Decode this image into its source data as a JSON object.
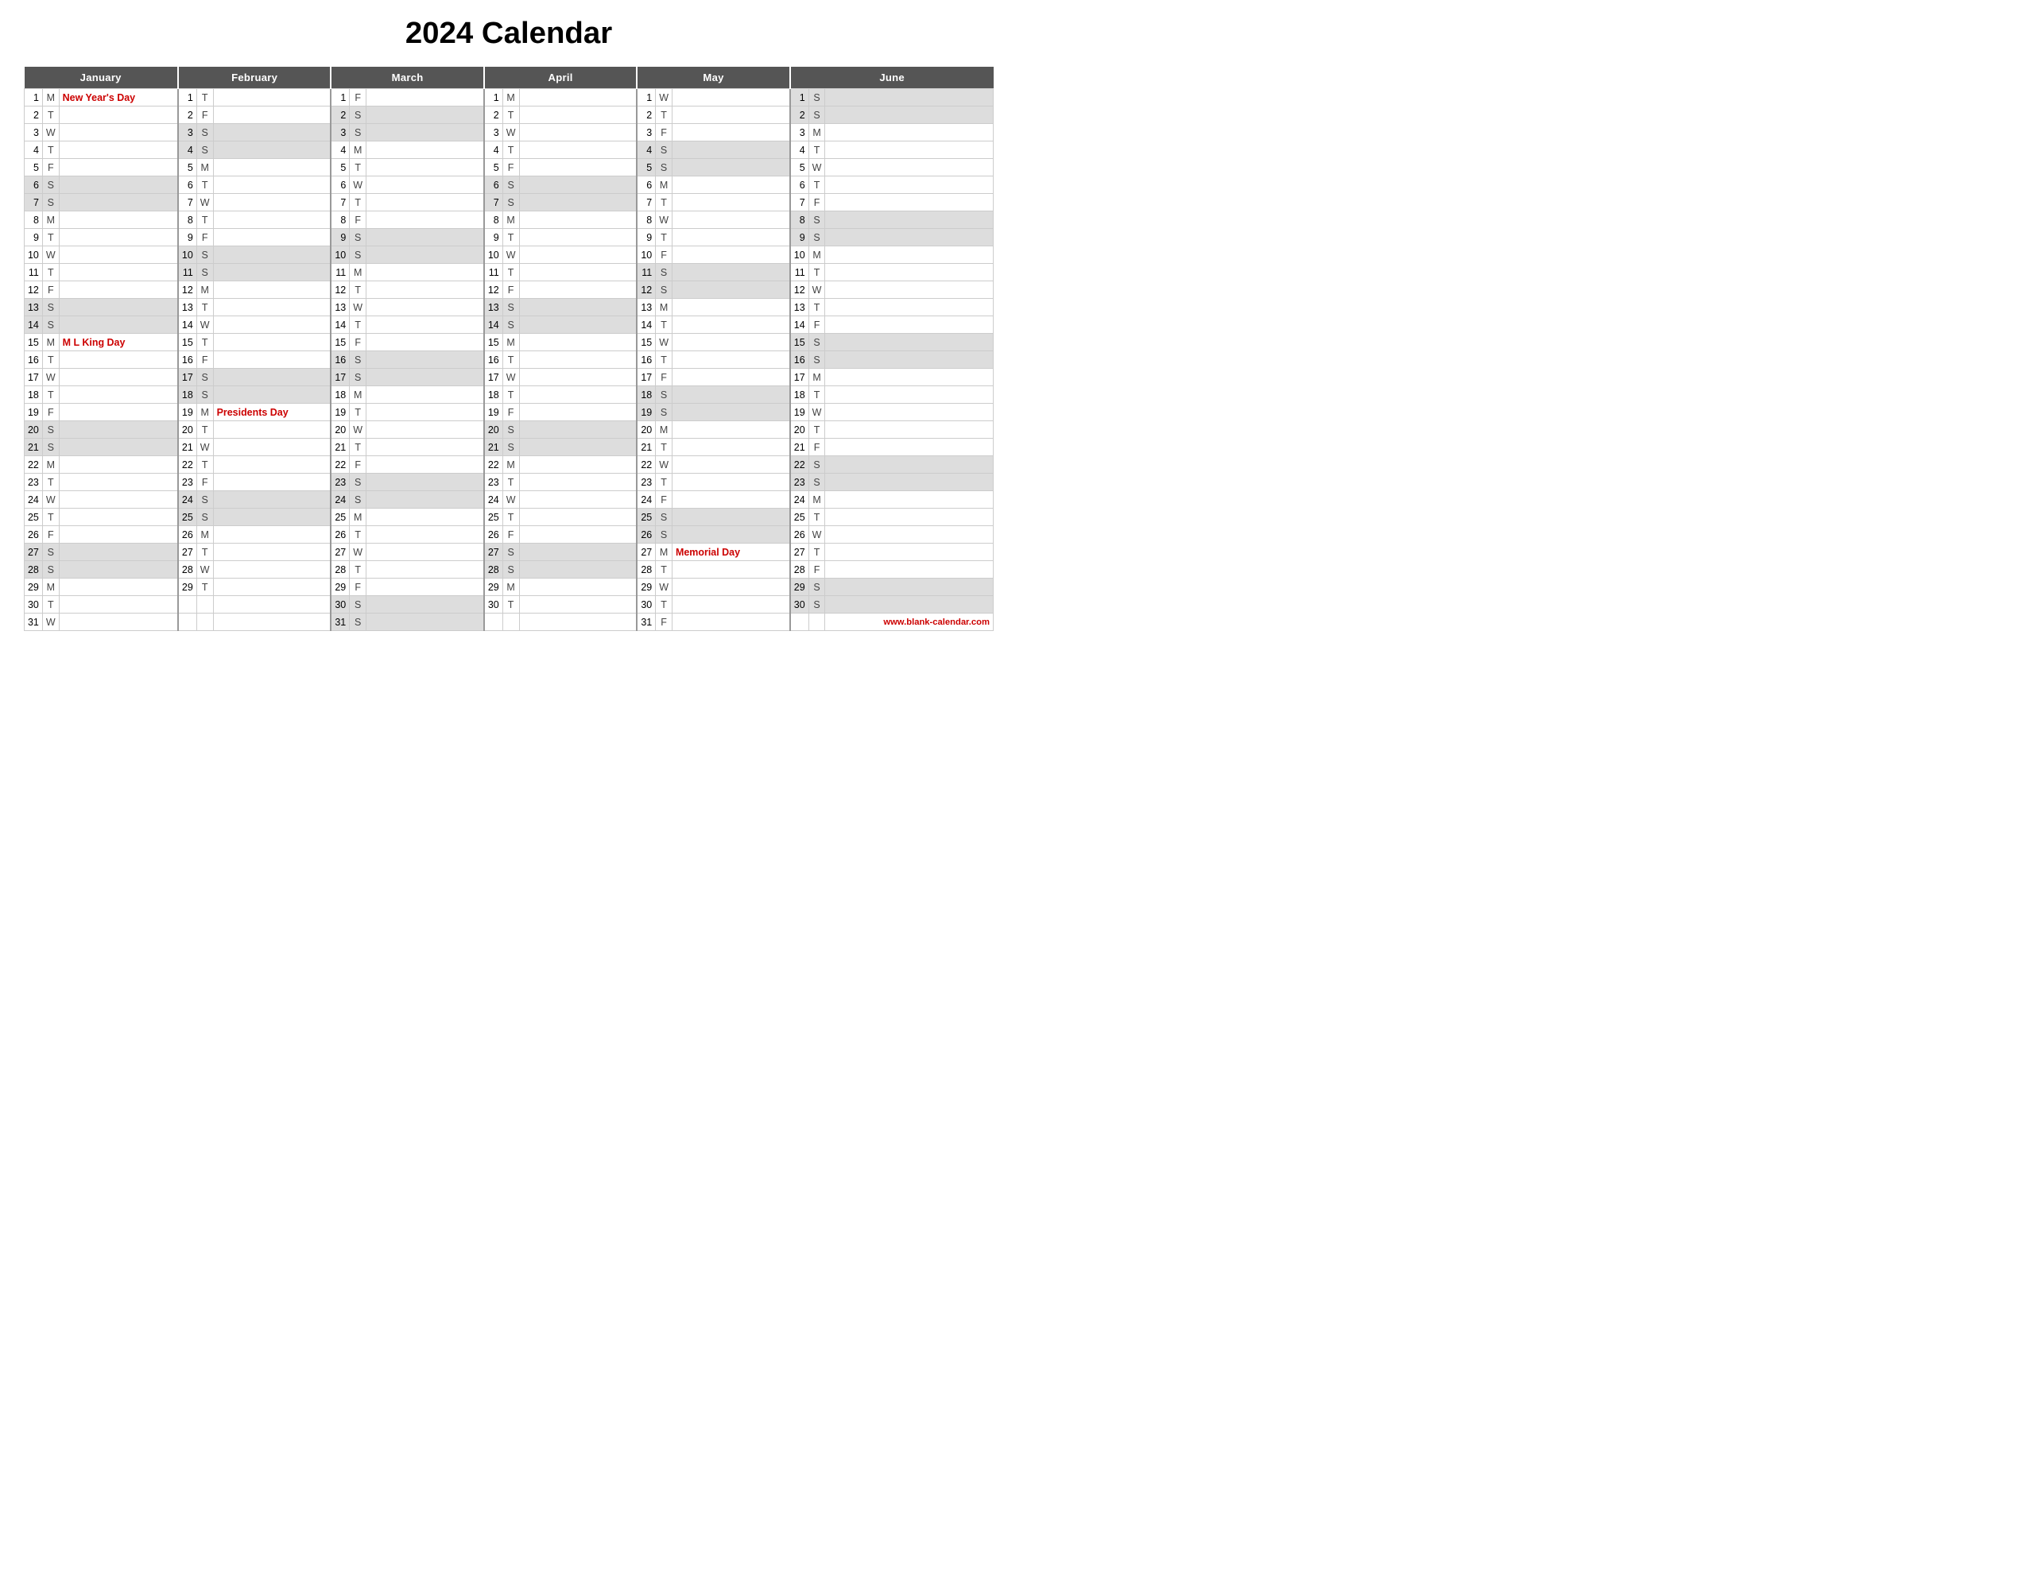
{
  "title": "2024 Calendar",
  "months": [
    "January",
    "February",
    "March",
    "April",
    "May",
    "June"
  ],
  "footer": "www.blank-calendar.com",
  "days": {
    "jan": [
      {
        "d": 1,
        "l": "M",
        "h": "New Year's Day"
      },
      {
        "d": 2,
        "l": "T",
        "h": ""
      },
      {
        "d": 3,
        "l": "W",
        "h": ""
      },
      {
        "d": 4,
        "l": "T",
        "h": ""
      },
      {
        "d": 5,
        "l": "F",
        "h": ""
      },
      {
        "d": 6,
        "l": "S",
        "h": ""
      },
      {
        "d": 7,
        "l": "S",
        "h": ""
      },
      {
        "d": 8,
        "l": "M",
        "h": ""
      },
      {
        "d": 9,
        "l": "T",
        "h": ""
      },
      {
        "d": 10,
        "l": "W",
        "h": ""
      },
      {
        "d": 11,
        "l": "T",
        "h": ""
      },
      {
        "d": 12,
        "l": "F",
        "h": ""
      },
      {
        "d": 13,
        "l": "S",
        "h": ""
      },
      {
        "d": 14,
        "l": "S",
        "h": ""
      },
      {
        "d": 15,
        "l": "M",
        "h": "M L King Day"
      },
      {
        "d": 16,
        "l": "T",
        "h": ""
      },
      {
        "d": 17,
        "l": "W",
        "h": ""
      },
      {
        "d": 18,
        "l": "T",
        "h": ""
      },
      {
        "d": 19,
        "l": "F",
        "h": ""
      },
      {
        "d": 20,
        "l": "S",
        "h": ""
      },
      {
        "d": 21,
        "l": "S",
        "h": ""
      },
      {
        "d": 22,
        "l": "M",
        "h": ""
      },
      {
        "d": 23,
        "l": "T",
        "h": ""
      },
      {
        "d": 24,
        "l": "W",
        "h": ""
      },
      {
        "d": 25,
        "l": "T",
        "h": ""
      },
      {
        "d": 26,
        "l": "F",
        "h": ""
      },
      {
        "d": 27,
        "l": "S",
        "h": ""
      },
      {
        "d": 28,
        "l": "S",
        "h": ""
      },
      {
        "d": 29,
        "l": "M",
        "h": ""
      },
      {
        "d": 30,
        "l": "T",
        "h": ""
      },
      {
        "d": 31,
        "l": "W",
        "h": ""
      }
    ],
    "feb": [
      {
        "d": 1,
        "l": "T",
        "h": ""
      },
      {
        "d": 2,
        "l": "F",
        "h": ""
      },
      {
        "d": 3,
        "l": "S",
        "h": ""
      },
      {
        "d": 4,
        "l": "S",
        "h": ""
      },
      {
        "d": 5,
        "l": "M",
        "h": ""
      },
      {
        "d": 6,
        "l": "T",
        "h": ""
      },
      {
        "d": 7,
        "l": "W",
        "h": ""
      },
      {
        "d": 8,
        "l": "T",
        "h": ""
      },
      {
        "d": 9,
        "l": "F",
        "h": ""
      },
      {
        "d": 10,
        "l": "S",
        "h": ""
      },
      {
        "d": 11,
        "l": "S",
        "h": ""
      },
      {
        "d": 12,
        "l": "M",
        "h": ""
      },
      {
        "d": 13,
        "l": "T",
        "h": ""
      },
      {
        "d": 14,
        "l": "W",
        "h": ""
      },
      {
        "d": 15,
        "l": "T",
        "h": ""
      },
      {
        "d": 16,
        "l": "F",
        "h": ""
      },
      {
        "d": 17,
        "l": "S",
        "h": ""
      },
      {
        "d": 18,
        "l": "S",
        "h": ""
      },
      {
        "d": 19,
        "l": "M",
        "h": "Presidents Day"
      },
      {
        "d": 20,
        "l": "T",
        "h": ""
      },
      {
        "d": 21,
        "l": "W",
        "h": ""
      },
      {
        "d": 22,
        "l": "T",
        "h": ""
      },
      {
        "d": 23,
        "l": "F",
        "h": ""
      },
      {
        "d": 24,
        "l": "S",
        "h": ""
      },
      {
        "d": 25,
        "l": "S",
        "h": ""
      },
      {
        "d": 26,
        "l": "M",
        "h": ""
      },
      {
        "d": 27,
        "l": "T",
        "h": ""
      },
      {
        "d": 28,
        "l": "W",
        "h": ""
      },
      {
        "d": 29,
        "l": "T",
        "h": ""
      },
      {
        "d": -1,
        "l": "",
        "h": ""
      },
      {
        "d": -1,
        "l": "",
        "h": ""
      }
    ],
    "mar": [
      {
        "d": 1,
        "l": "F",
        "h": ""
      },
      {
        "d": 2,
        "l": "S",
        "h": ""
      },
      {
        "d": 3,
        "l": "S",
        "h": ""
      },
      {
        "d": 4,
        "l": "M",
        "h": ""
      },
      {
        "d": 5,
        "l": "T",
        "h": ""
      },
      {
        "d": 6,
        "l": "W",
        "h": ""
      },
      {
        "d": 7,
        "l": "T",
        "h": ""
      },
      {
        "d": 8,
        "l": "F",
        "h": ""
      },
      {
        "d": 9,
        "l": "S",
        "h": ""
      },
      {
        "d": 10,
        "l": "S",
        "h": ""
      },
      {
        "d": 11,
        "l": "M",
        "h": ""
      },
      {
        "d": 12,
        "l": "T",
        "h": ""
      },
      {
        "d": 13,
        "l": "W",
        "h": ""
      },
      {
        "d": 14,
        "l": "T",
        "h": ""
      },
      {
        "d": 15,
        "l": "F",
        "h": ""
      },
      {
        "d": 16,
        "l": "S",
        "h": ""
      },
      {
        "d": 17,
        "l": "S",
        "h": ""
      },
      {
        "d": 18,
        "l": "M",
        "h": ""
      },
      {
        "d": 19,
        "l": "T",
        "h": ""
      },
      {
        "d": 20,
        "l": "W",
        "h": ""
      },
      {
        "d": 21,
        "l": "T",
        "h": ""
      },
      {
        "d": 22,
        "l": "F",
        "h": ""
      },
      {
        "d": 23,
        "l": "S",
        "h": ""
      },
      {
        "d": 24,
        "l": "S",
        "h": ""
      },
      {
        "d": 25,
        "l": "M",
        "h": ""
      },
      {
        "d": 26,
        "l": "T",
        "h": ""
      },
      {
        "d": 27,
        "l": "W",
        "h": ""
      },
      {
        "d": 28,
        "l": "T",
        "h": ""
      },
      {
        "d": 29,
        "l": "F",
        "h": ""
      },
      {
        "d": 30,
        "l": "S",
        "h": ""
      },
      {
        "d": 31,
        "l": "S",
        "h": ""
      }
    ],
    "apr": [
      {
        "d": 1,
        "l": "M",
        "h": ""
      },
      {
        "d": 2,
        "l": "T",
        "h": ""
      },
      {
        "d": 3,
        "l": "W",
        "h": ""
      },
      {
        "d": 4,
        "l": "T",
        "h": ""
      },
      {
        "d": 5,
        "l": "F",
        "h": ""
      },
      {
        "d": 6,
        "l": "S",
        "h": ""
      },
      {
        "d": 7,
        "l": "S",
        "h": ""
      },
      {
        "d": 8,
        "l": "M",
        "h": ""
      },
      {
        "d": 9,
        "l": "T",
        "h": ""
      },
      {
        "d": 10,
        "l": "W",
        "h": ""
      },
      {
        "d": 11,
        "l": "T",
        "h": ""
      },
      {
        "d": 12,
        "l": "F",
        "h": ""
      },
      {
        "d": 13,
        "l": "S",
        "h": ""
      },
      {
        "d": 14,
        "l": "S",
        "h": ""
      },
      {
        "d": 15,
        "l": "M",
        "h": ""
      },
      {
        "d": 16,
        "l": "T",
        "h": ""
      },
      {
        "d": 17,
        "l": "W",
        "h": ""
      },
      {
        "d": 18,
        "l": "T",
        "h": ""
      },
      {
        "d": 19,
        "l": "F",
        "h": ""
      },
      {
        "d": 20,
        "l": "S",
        "h": ""
      },
      {
        "d": 21,
        "l": "S",
        "h": ""
      },
      {
        "d": 22,
        "l": "M",
        "h": ""
      },
      {
        "d": 23,
        "l": "T",
        "h": ""
      },
      {
        "d": 24,
        "l": "W",
        "h": ""
      },
      {
        "d": 25,
        "l": "T",
        "h": ""
      },
      {
        "d": 26,
        "l": "F",
        "h": ""
      },
      {
        "d": 27,
        "l": "S",
        "h": ""
      },
      {
        "d": 28,
        "l": "S",
        "h": ""
      },
      {
        "d": 29,
        "l": "M",
        "h": ""
      },
      {
        "d": 30,
        "l": "T",
        "h": ""
      },
      {
        "d": -1,
        "l": "",
        "h": ""
      }
    ],
    "may": [
      {
        "d": 1,
        "l": "W",
        "h": ""
      },
      {
        "d": 2,
        "l": "T",
        "h": ""
      },
      {
        "d": 3,
        "l": "F",
        "h": ""
      },
      {
        "d": 4,
        "l": "S",
        "h": ""
      },
      {
        "d": 5,
        "l": "S",
        "h": ""
      },
      {
        "d": 6,
        "l": "M",
        "h": ""
      },
      {
        "d": 7,
        "l": "T",
        "h": ""
      },
      {
        "d": 8,
        "l": "W",
        "h": ""
      },
      {
        "d": 9,
        "l": "T",
        "h": ""
      },
      {
        "d": 10,
        "l": "F",
        "h": ""
      },
      {
        "d": 11,
        "l": "S",
        "h": ""
      },
      {
        "d": 12,
        "l": "S",
        "h": ""
      },
      {
        "d": 13,
        "l": "M",
        "h": ""
      },
      {
        "d": 14,
        "l": "T",
        "h": ""
      },
      {
        "d": 15,
        "l": "W",
        "h": ""
      },
      {
        "d": 16,
        "l": "T",
        "h": ""
      },
      {
        "d": 17,
        "l": "F",
        "h": ""
      },
      {
        "d": 18,
        "l": "S",
        "h": ""
      },
      {
        "d": 19,
        "l": "S",
        "h": ""
      },
      {
        "d": 20,
        "l": "M",
        "h": ""
      },
      {
        "d": 21,
        "l": "T",
        "h": ""
      },
      {
        "d": 22,
        "l": "W",
        "h": ""
      },
      {
        "d": 23,
        "l": "T",
        "h": ""
      },
      {
        "d": 24,
        "l": "F",
        "h": ""
      },
      {
        "d": 25,
        "l": "S",
        "h": ""
      },
      {
        "d": 26,
        "l": "S",
        "h": ""
      },
      {
        "d": 27,
        "l": "M",
        "h": "Memorial Day"
      },
      {
        "d": 28,
        "l": "T",
        "h": ""
      },
      {
        "d": 29,
        "l": "W",
        "h": ""
      },
      {
        "d": 30,
        "l": "T",
        "h": ""
      },
      {
        "d": 31,
        "l": "F",
        "h": ""
      }
    ],
    "jun": [
      {
        "d": 1,
        "l": "S",
        "h": ""
      },
      {
        "d": 2,
        "l": "S",
        "h": ""
      },
      {
        "d": 3,
        "l": "M",
        "h": ""
      },
      {
        "d": 4,
        "l": "T",
        "h": ""
      },
      {
        "d": 5,
        "l": "W",
        "h": ""
      },
      {
        "d": 6,
        "l": "T",
        "h": ""
      },
      {
        "d": 7,
        "l": "F",
        "h": ""
      },
      {
        "d": 8,
        "l": "S",
        "h": ""
      },
      {
        "d": 9,
        "l": "S",
        "h": ""
      },
      {
        "d": 10,
        "l": "M",
        "h": ""
      },
      {
        "d": 11,
        "l": "T",
        "h": ""
      },
      {
        "d": 12,
        "l": "W",
        "h": ""
      },
      {
        "d": 13,
        "l": "T",
        "h": ""
      },
      {
        "d": 14,
        "l": "F",
        "h": ""
      },
      {
        "d": 15,
        "l": "S",
        "h": ""
      },
      {
        "d": 16,
        "l": "S",
        "h": ""
      },
      {
        "d": 17,
        "l": "M",
        "h": ""
      },
      {
        "d": 18,
        "l": "T",
        "h": ""
      },
      {
        "d": 19,
        "l": "W",
        "h": ""
      },
      {
        "d": 20,
        "l": "T",
        "h": ""
      },
      {
        "d": 21,
        "l": "F",
        "h": ""
      },
      {
        "d": 22,
        "l": "S",
        "h": ""
      },
      {
        "d": 23,
        "l": "S",
        "h": ""
      },
      {
        "d": 24,
        "l": "M",
        "h": ""
      },
      {
        "d": 25,
        "l": "T",
        "h": ""
      },
      {
        "d": 26,
        "l": "W",
        "h": ""
      },
      {
        "d": 27,
        "l": "T",
        "h": ""
      },
      {
        "d": 28,
        "l": "F",
        "h": ""
      },
      {
        "d": 29,
        "l": "S",
        "h": ""
      },
      {
        "d": 30,
        "l": "S",
        "h": ""
      },
      {
        "d": -1,
        "l": "",
        "h": ""
      }
    ]
  }
}
